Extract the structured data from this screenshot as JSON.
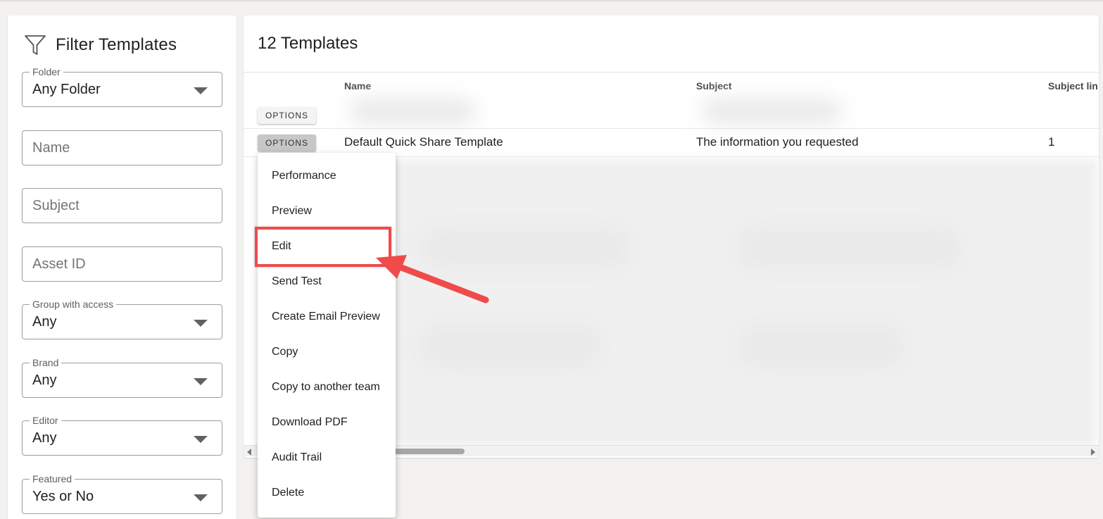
{
  "sidebar": {
    "title": "Filter Templates",
    "icon": "filter-icon",
    "fields": {
      "folder": {
        "label": "Folder",
        "value": "Any Folder"
      },
      "name": {
        "placeholder": "Name"
      },
      "subject": {
        "placeholder": "Subject"
      },
      "asset_id": {
        "placeholder": "Asset ID"
      },
      "group": {
        "label": "Group with access",
        "value": "Any"
      },
      "brand": {
        "label": "Brand",
        "value": "Any"
      },
      "editor": {
        "label": "Editor",
        "value": "Any"
      },
      "featured": {
        "label": "Featured",
        "value": "Yes or No"
      }
    }
  },
  "main": {
    "title": "12 Templates",
    "columns": [
      "Name",
      "Subject",
      "Subject lin"
    ],
    "options_label": "OPTIONS",
    "rows": [
      {
        "name": "Default Quick Share Template",
        "subject": "The information you requested",
        "subject_lines": "1"
      }
    ]
  },
  "menu": {
    "items": [
      "Performance",
      "Preview",
      "Edit",
      "Send Test",
      "Create Email Preview",
      "Copy",
      "Copy to another team",
      "Download PDF",
      "Audit Trail",
      "Delete"
    ],
    "highlighted": "Edit"
  },
  "colors": {
    "annotation": "#ef4b4b",
    "options_active": "#c7c7c7"
  }
}
